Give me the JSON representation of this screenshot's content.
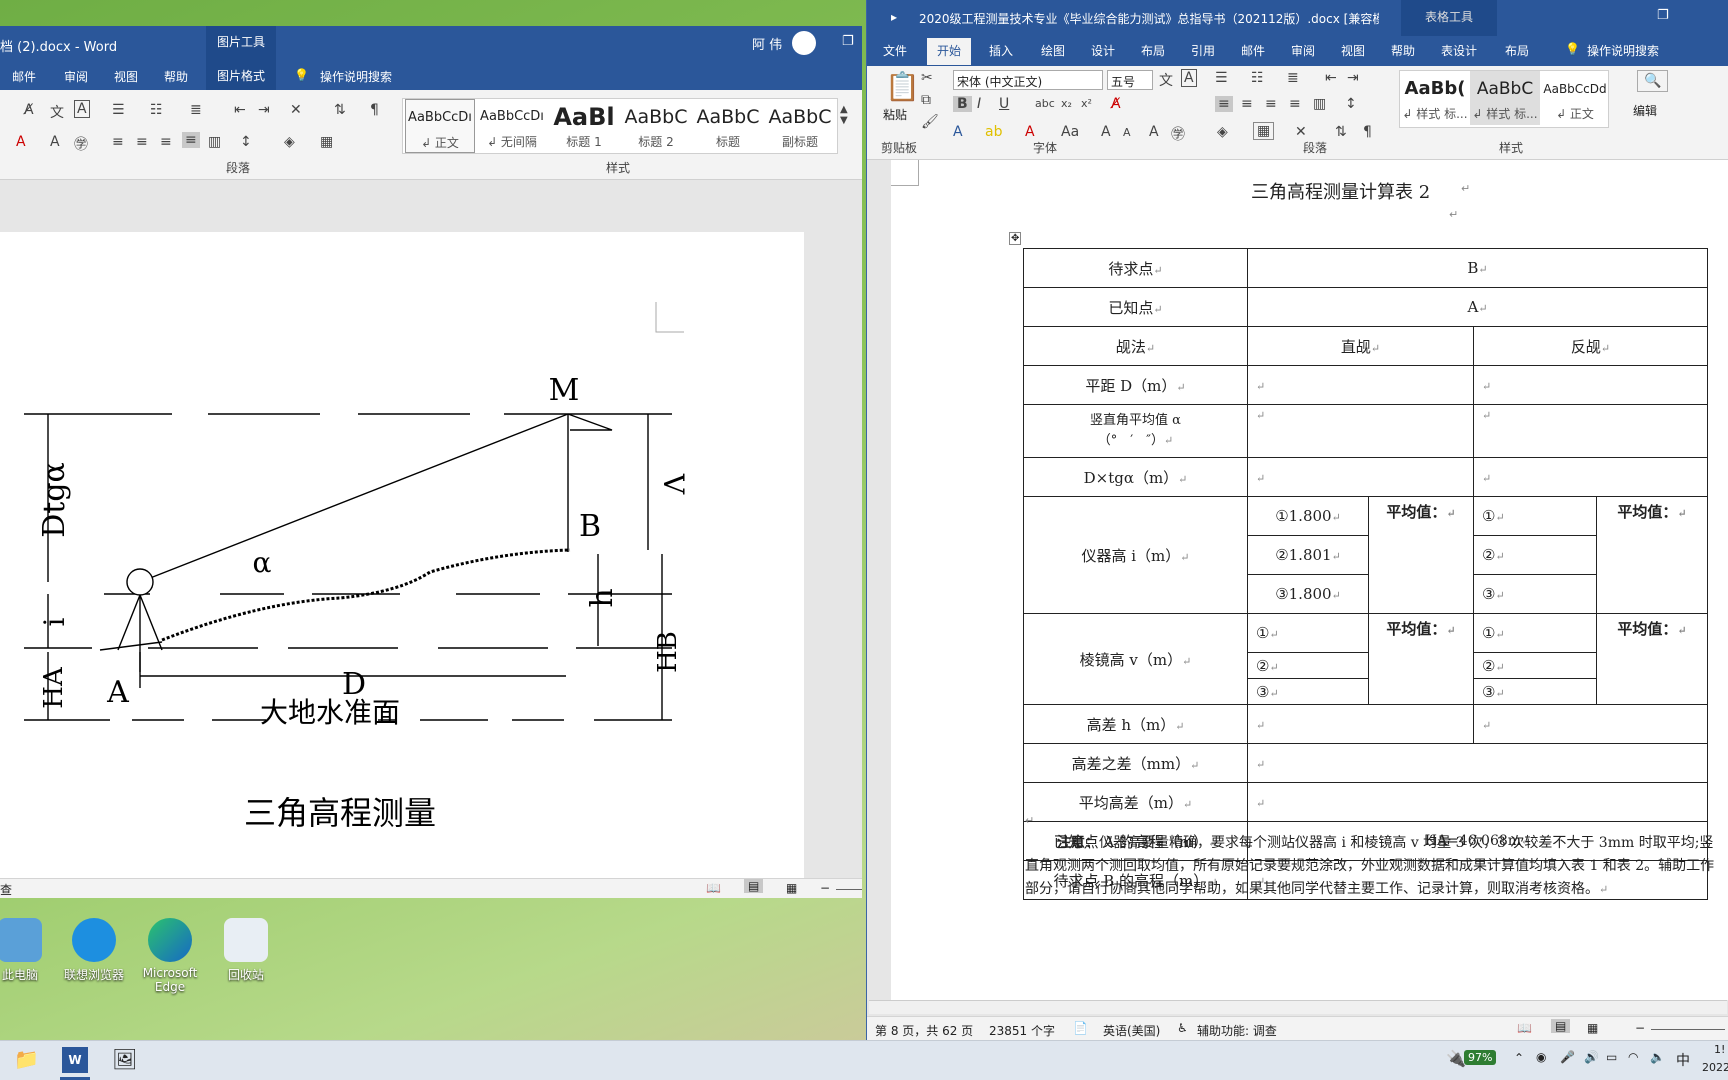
{
  "left_window": {
    "title": "档 (2).docx  -  Word",
    "picture_tools": "图片工具",
    "user": "阿 伟",
    "tabs": [
      "邮件",
      "审阅",
      "视图",
      "帮助",
      "图片格式"
    ],
    "search": "操作说明搜索",
    "groups": {
      "paragraph": "段落",
      "styles": "样式"
    },
    "styles": [
      {
        "sample": "AaBbCcDı",
        "name": "↲ 正文"
      },
      {
        "sample": "AaBbCcDı",
        "name": "↲ 无间隔"
      },
      {
        "sample": "AaBl",
        "name": "标题 1"
      },
      {
        "sample": "AaBbC",
        "name": "标题 2"
      },
      {
        "sample": "AaBbC",
        "name": "标题"
      },
      {
        "sample": "AaBbC",
        "name": "副标题"
      }
    ],
    "status_left": "查",
    "figure": {
      "labels": {
        "M": "M",
        "B": "B",
        "A": "A",
        "alpha": "α",
        "dtga": "Dtgα",
        "i": "i",
        "ha": "HA",
        "v": "V",
        "h": "h",
        "hb": "HB",
        "d": "D"
      },
      "datum": "大地水准面",
      "caption": "三角高程测量"
    }
  },
  "right_window": {
    "title": "2020级工程测量技术专业《毕业综合能力测试》总指导书（202112版）.docx [兼容模式]  -...",
    "table_tools": "表格工具",
    "tabs": [
      "文件",
      "开始",
      "插入",
      "绘图",
      "设计",
      "布局",
      "引用",
      "邮件",
      "审阅",
      "视图",
      "帮助",
      "表设计",
      "布局"
    ],
    "search": "操作说明搜索",
    "font_name": "宋体 (中文正文)",
    "font_size": "五号",
    "groups": {
      "clipboard": "剪贴板",
      "font": "字体",
      "paragraph": "段落",
      "styles": "样式",
      "edit": "编辑"
    },
    "paste": "粘贴",
    "styles": [
      {
        "sample": "AaBb(",
        "name": "↲ 样式 标..."
      },
      {
        "sample": "AaBbC",
        "name": "↲ 样式 标..."
      },
      {
        "sample": "AaBbCcDd",
        "name": "↲ 正文"
      }
    ],
    "doc": {
      "heading": "三角高程测量计算表 2",
      "rows": {
        "r1": {
          "label": "待求点",
          "value": "B"
        },
        "r2": {
          "label": "已知点",
          "value": "A"
        },
        "r3": {
          "label": "觇法",
          "direct": "直觇",
          "reverse": "反觇"
        },
        "r4": {
          "label": "平距 D（m）"
        },
        "r5": {
          "label1": "竖直角平均值 α",
          "label2": "（°　′　″）"
        },
        "r6": {
          "label": "D×tgα（m）"
        },
        "r7": {
          "label": "仪器高 i（m）",
          "d1": "①1.800",
          "d2": "②1.801",
          "d3": "③1.800",
          "avg": "平均值：",
          "r1": "①",
          "r2": "②",
          "r3": "③"
        },
        "r8": {
          "label": "棱镜高 v（m）",
          "d1": "①",
          "d2": "②",
          "d3": "③",
          "avg": "平均值：",
          "r1": "①",
          "r2": "②",
          "r3": "③"
        },
        "r9": {
          "label": "高差 h（m）"
        },
        "r10": {
          "label": "高差之差（mm）"
        },
        "r11": {
          "label": "平均高差（m）"
        },
        "r12": {
          "label": "已知点 A 的高程（m）",
          "value": "HA=46.068m"
        },
        "r13": {
          "label": "待求点 B 的高程（m）"
        }
      },
      "note_bold": "注意：",
      "note": "仪器高要量精确，要求每个测站仪器高 i 和棱镜高 v 均量 3 次，3 次较差不大于 3mm 时取平均;竖直角观测两个测回取均值，所有原始记录要规范涂改，外业观测数据和成果计算值均填入表 1 和表 2。辅助工作部分，请自行协商其他同学帮助，如果其他同学代替主要工作、记录计算，则取消考核资格。"
    },
    "status": {
      "page": "第 8 页，共 62 页",
      "words": "23851 个字",
      "lang": "英语(美国)",
      "access": "辅助功能: 调查"
    }
  },
  "desktop_icons": [
    "此电脑",
    "联想浏览器",
    "Microsoft Edge",
    "回收站"
  ],
  "taskbar": {
    "battery": "97%",
    "ime": "中",
    "time": "1!",
    "date": "2022"
  }
}
